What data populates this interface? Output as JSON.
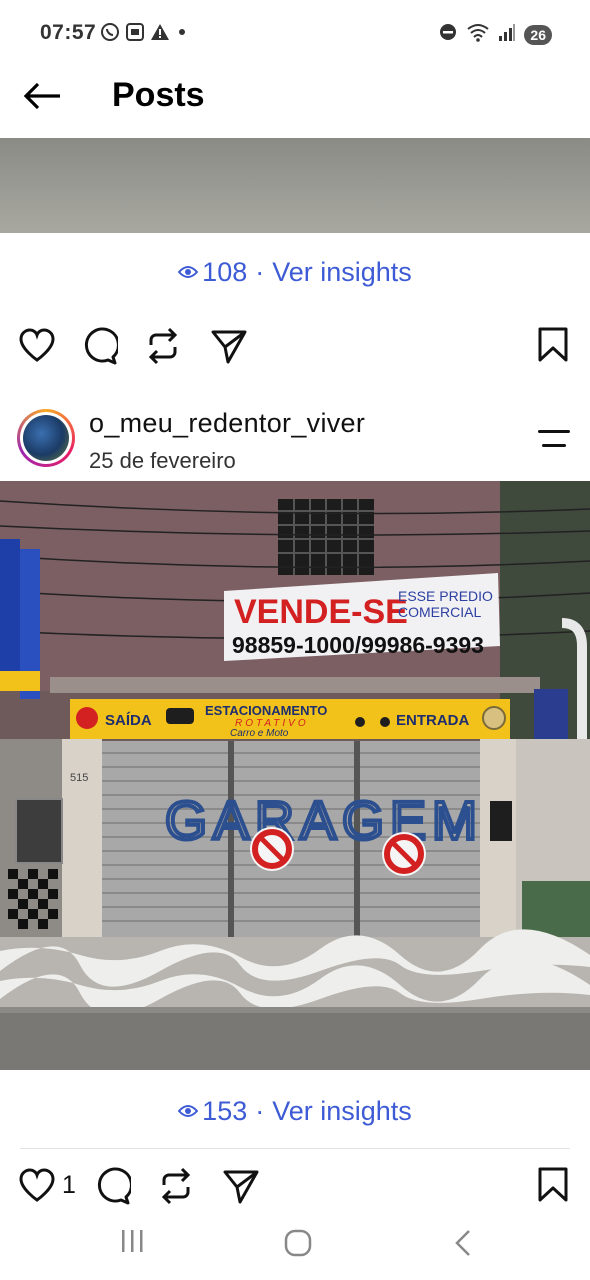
{
  "status_bar": {
    "time": "07:57",
    "battery": "26",
    "left_icons": [
      "whatsapp-icon",
      "screenshot-icon",
      "warning-icon",
      "dot-icon"
    ],
    "right_icons": [
      "dnd-icon",
      "wifi-icon",
      "signal-icon"
    ]
  },
  "header": {
    "title": "Posts",
    "back_icon": "arrow-left-icon"
  },
  "previous_post": {
    "views": "108",
    "separator": "·",
    "insights_label": "Ver insights",
    "actions": [
      "heart-icon",
      "comment-icon",
      "repost-icon",
      "share-icon",
      "bookmark-icon"
    ]
  },
  "post": {
    "username": "o_meu_redentor_viver",
    "date": "25 de fevereiro",
    "menu_icon": "more-icon",
    "image_text": {
      "sign_main": "VENDE-SE",
      "sign_sub1": "ESSE PREDIO",
      "sign_sub2": "COMERCIAL",
      "sign_phone": "98859-1000/99986-9393",
      "banner_left": "SAÍDA",
      "banner_center": "ESTACIONAMENTO",
      "banner_center_sub1": "ROTATIVO",
      "banner_center_sub2": "Carro e Moto",
      "banner_right": "ENTRADA",
      "door_number": "515",
      "graffiti": "GARAGEM"
    },
    "views": "153",
    "separator": "·",
    "insights_label": "Ver insights",
    "like_count": "1",
    "actions": [
      "heart-icon",
      "comment-icon",
      "repost-icon",
      "share-icon",
      "bookmark-icon"
    ]
  },
  "nav_bar": {
    "buttons": [
      "recents-icon",
      "home-icon",
      "back-icon"
    ]
  },
  "colors": {
    "accent": "#3e5bd6",
    "banner_yellow": "#f2c21b",
    "sign_red": "#d32020"
  }
}
